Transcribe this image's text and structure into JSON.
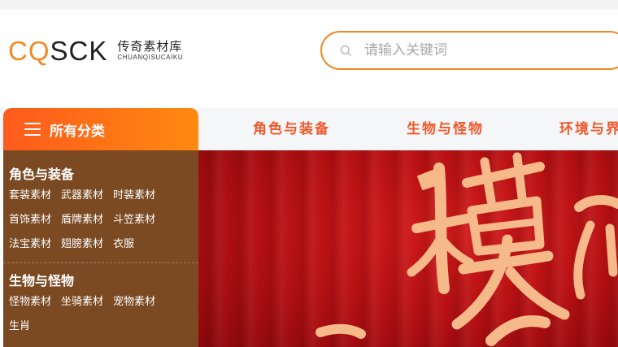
{
  "logo": {
    "mark_orange": "CQ",
    "mark_dark": "SCK",
    "name_cn": "传奇素材库",
    "name_en": "CHUANQISUCAIKU"
  },
  "search": {
    "placeholder": "请输入关键词",
    "value": ""
  },
  "nav": {
    "all_categories": "所有分类",
    "items": [
      "角色与装备",
      "生物与怪物",
      "环境与界"
    ]
  },
  "categories": [
    {
      "title": "角色与装备",
      "links": [
        "套装素材",
        "武器素材",
        "时装素材",
        "首饰素材",
        "盾牌素材",
        "斗笠素材",
        "法宝素材",
        "翅膀素材",
        "衣服"
      ]
    },
    {
      "title": "生物与怪物",
      "links": [
        "怪物素材",
        "坐骑素材",
        "宠物素材",
        "生肖"
      ]
    }
  ],
  "colors": {
    "accent": "#f08a24",
    "nav_text": "#f0582a",
    "panel_bg": "#7b4a22",
    "banner_red": "#b40f12",
    "banner_glyph": "#f6b98a"
  },
  "icons": {
    "search": "search-icon",
    "menu": "menu-icon"
  }
}
